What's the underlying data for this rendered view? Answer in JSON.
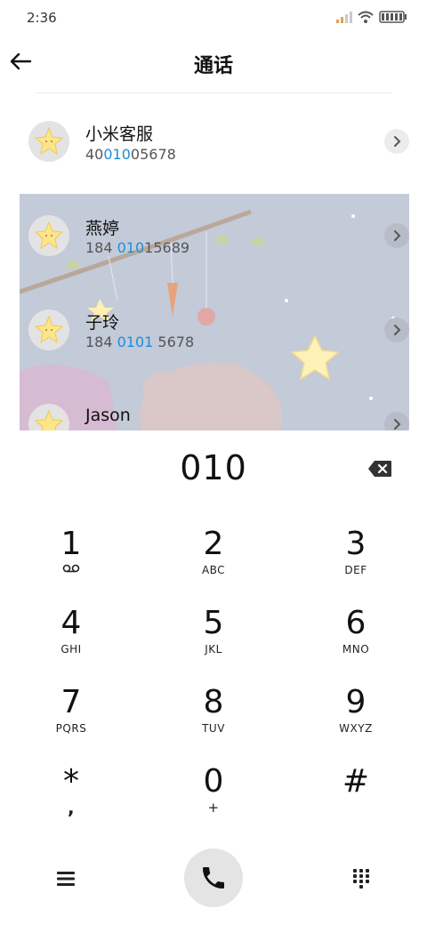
{
  "status_bar": {
    "time": "2:36"
  },
  "header": {
    "title": "通话"
  },
  "contacts": [
    {
      "name": "小米客服",
      "number_parts": [
        "40",
        "010",
        "05678"
      ]
    },
    {
      "name": "燕婷",
      "number_parts": [
        "184 ",
        "010",
        "15689"
      ]
    },
    {
      "name": "子玲",
      "number_parts": [
        "184 ",
        "0101",
        " 5678"
      ]
    },
    {
      "name": "Jason",
      "number_parts": [
        "",
        "",
        ""
      ]
    }
  ],
  "dialer": {
    "number": "010"
  },
  "keypad": [
    {
      "digit": "1",
      "letters": ""
    },
    {
      "digit": "2",
      "letters": "ABC"
    },
    {
      "digit": "3",
      "letters": "DEF"
    },
    {
      "digit": "4",
      "letters": "GHI"
    },
    {
      "digit": "5",
      "letters": "JKL"
    },
    {
      "digit": "6",
      "letters": "MNO"
    },
    {
      "digit": "7",
      "letters": "PQRS"
    },
    {
      "digit": "8",
      "letters": "TUV"
    },
    {
      "digit": "9",
      "letters": "WXYZ"
    },
    {
      "digit": "*",
      "letters": ","
    },
    {
      "digit": "0",
      "letters": "+"
    },
    {
      "digit": "#",
      "letters": ""
    }
  ],
  "icons": {
    "back": "arrow-left-icon",
    "backspace": "backspace-icon",
    "menu": "menu-icon",
    "call": "phone-icon",
    "keypad": "dialpad-icon",
    "voicemail": "voicemail-icon",
    "avatar": "star-avatar-icon",
    "chevron": "chevron-right-icon"
  },
  "colors": {
    "highlight": "#1a8fdc",
    "results_background": "#c3cad8",
    "call_button": "#e4e4e4"
  }
}
